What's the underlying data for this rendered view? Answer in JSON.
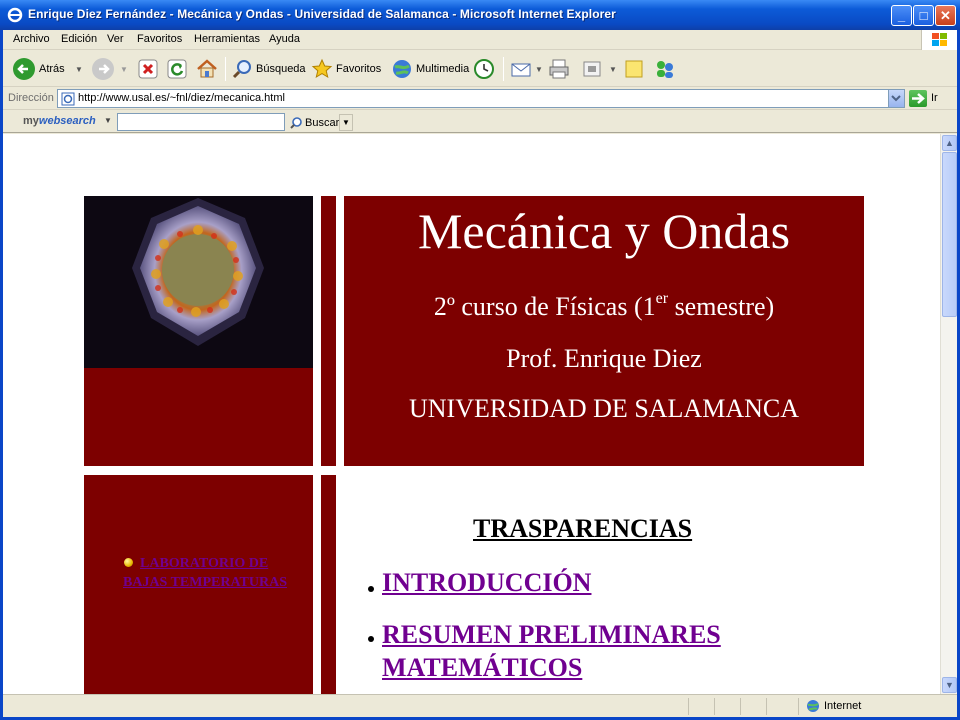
{
  "window": {
    "title": "Enrique Diez Fernández - Mecánica y Ondas - Universidad de Salamanca - Microsoft Internet Explorer"
  },
  "menu": [
    "Archivo",
    "Edición",
    "Ver",
    "Favoritos",
    "Herramientas",
    "Ayuda"
  ],
  "toolbar": {
    "back_label": "Atrás",
    "search_label": "Búsqueda",
    "favorites_label": "Favoritos",
    "media_label": "Multimedia"
  },
  "address": {
    "label": "Dirección",
    "url": "http://www.usal.es/~fnl/diez/mecanica.html",
    "go_label": "Ir"
  },
  "searchbar": {
    "brand_prefix": "my",
    "brand_suffix": "websearch",
    "button_label": "Buscar"
  },
  "page": {
    "title": "Mecánica y Ondas",
    "course_prefix": "2º curso de Físicas (1",
    "course_sup": "er",
    "course_suffix": " semestre)",
    "professor": "Prof. Enrique Diez",
    "university": "UNIVERSIDAD DE SALAMANCA",
    "side_link": "LABORATORIO DE BAJAS TEMPERATURAS",
    "section_title": "TRASPARENCIAS",
    "links": [
      "INTRODUCCIÓN",
      "RESUMEN PRELIMINARES MATEMÁTICOS"
    ]
  },
  "status": {
    "zone": "Internet"
  },
  "colors": {
    "maroon": "#7d0000",
    "link": "#700090"
  }
}
